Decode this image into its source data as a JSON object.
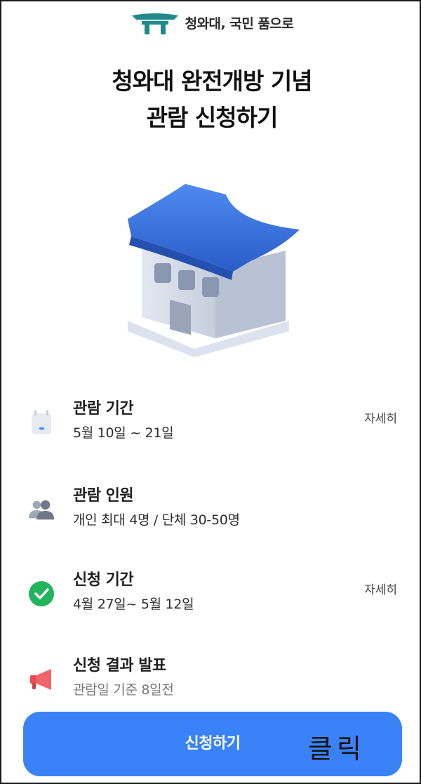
{
  "brand": {
    "logo_icon": "blue-house-roof-icon",
    "text": "청와대, 국민 품으로"
  },
  "title": {
    "line1": "청와대 완전개방 기념",
    "line2": "관람 신청하기"
  },
  "hero": {
    "icon": "blue-house-building-illustration"
  },
  "info": [
    {
      "icon": "calendar-icon",
      "title": "관람 기간",
      "sub": "5월 10일 ~ 21일",
      "link": "자세히"
    },
    {
      "icon": "people-icon",
      "title": "관람 인원",
      "sub": "개인 최대 4명 / 단체 30-50명"
    },
    {
      "icon": "check-circle-icon",
      "title": "신청 기간",
      "sub": "4월 27일~ 5월 12일",
      "link": "자세히"
    },
    {
      "icon": "megaphone-icon",
      "title": "신청 결과 발표",
      "sub": "관람일 기준 8일전"
    }
  ],
  "apply": {
    "label": "신청하기",
    "note": "클릭"
  },
  "colors": {
    "accent": "#3a82f7",
    "check": "#22b45d",
    "megaphone": "#ef4a52",
    "roof": "#3c6fd8"
  }
}
